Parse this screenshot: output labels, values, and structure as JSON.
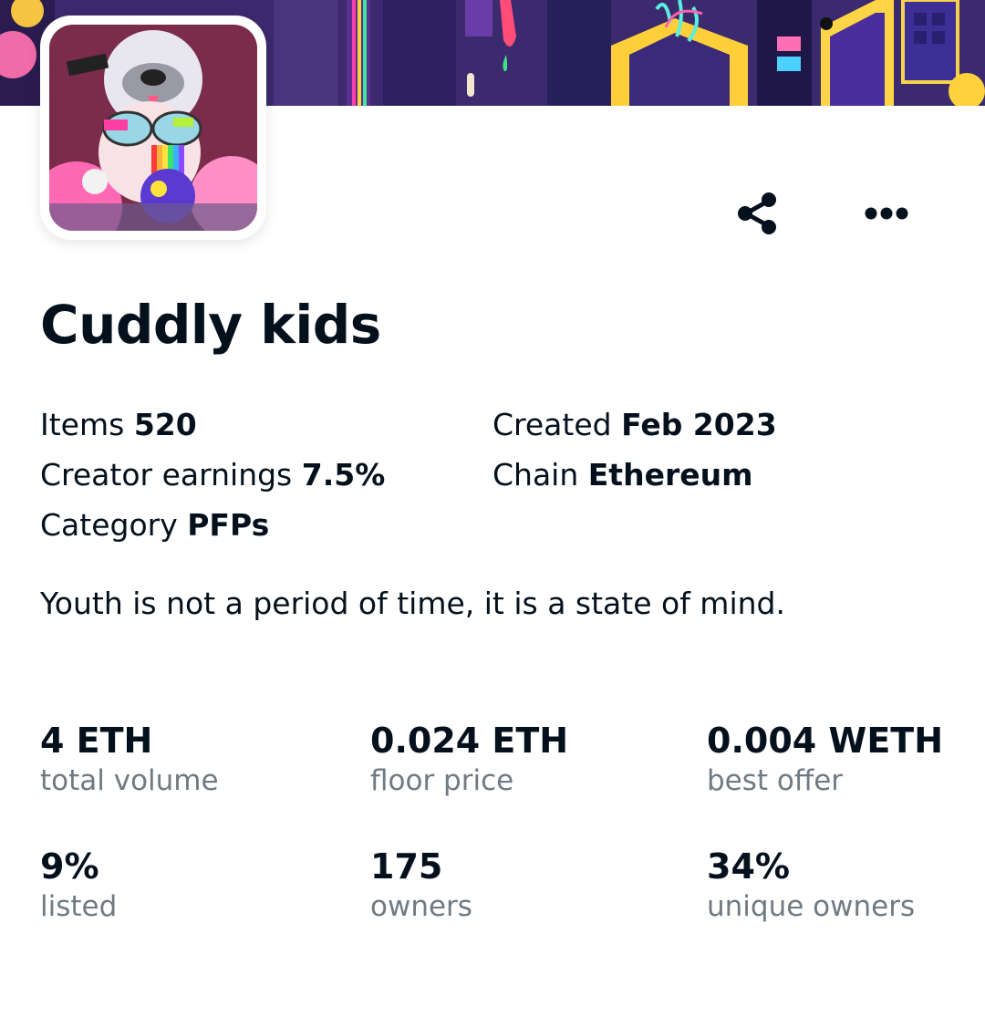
{
  "collection": {
    "name": "Cuddly kids",
    "description": "Youth is not a period of time, it is a state of mind."
  },
  "details": {
    "items_label": "Items",
    "items_value": "520",
    "earnings_label": "Creator earnings",
    "earnings_value": "7.5%",
    "category_label": "Category",
    "category_value": "PFPs",
    "created_label": "Created",
    "created_value": "Feb 2023",
    "chain_label": "Chain",
    "chain_value": "Ethereum"
  },
  "stats": [
    {
      "value": "4 ETH",
      "label": "total volume"
    },
    {
      "value": "0.024 ETH",
      "label": "floor price"
    },
    {
      "value": "0.004 WETH",
      "label": "best offer"
    },
    {
      "value": "9%",
      "label": "listed"
    },
    {
      "value": "175",
      "label": "owners"
    },
    {
      "value": "34%",
      "label": "unique owners"
    }
  ],
  "icons": {
    "share": "share-icon",
    "more": "more-options-icon"
  },
  "colors": {
    "text_primary": "#04111d",
    "text_secondary": "#707a83",
    "banner_base": "#3b2a6e"
  }
}
